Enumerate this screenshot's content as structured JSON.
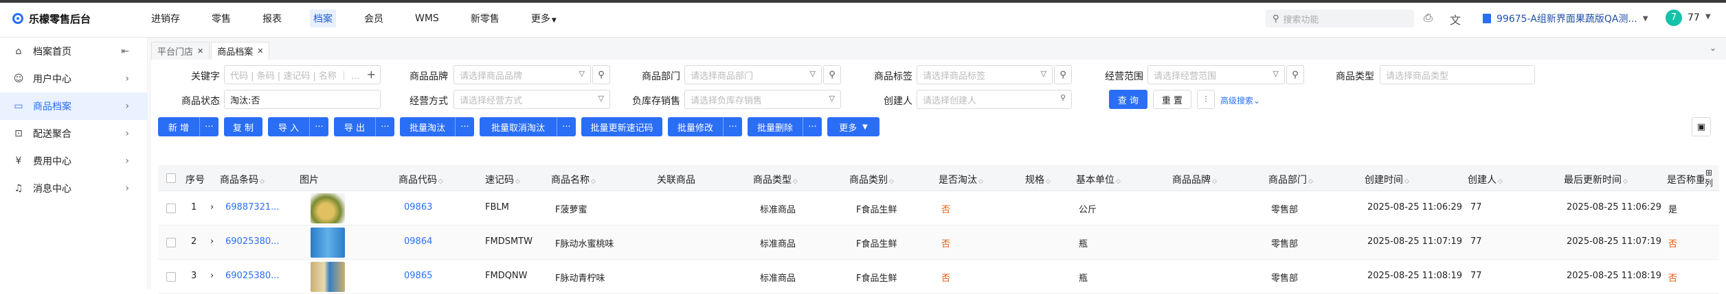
{
  "app": {
    "title": "乐檬零售后台"
  },
  "nav": [
    {
      "label": "进销存"
    },
    {
      "label": "零售"
    },
    {
      "label": "报表"
    },
    {
      "label": "档案"
    },
    {
      "label": "会员"
    },
    {
      "label": "WMS"
    },
    {
      "label": "新零售"
    },
    {
      "label": "更多"
    }
  ],
  "topbar": {
    "search_placeholder": "搜索功能",
    "org": "99675-A组新界面果蔬版QA测...",
    "avatar_text": "7",
    "user": "77"
  },
  "sidebar": [
    {
      "label": "档案首页"
    },
    {
      "label": "用户中心"
    },
    {
      "label": "商品档案"
    },
    {
      "label": "配送聚合"
    },
    {
      "label": "费用中心"
    },
    {
      "label": "消息中心"
    }
  ],
  "tabs": [
    {
      "label": "平台门店"
    },
    {
      "label": "商品档案"
    }
  ],
  "filters": {
    "keyword_label": "关键字",
    "keyword_ph": "代码 | 条码 | 速记码 | 名称 ｜ ...",
    "brand_label": "商品品牌",
    "brand_ph": "请选择商品品牌",
    "dept_label": "商品部门",
    "dept_ph": "请选择商品部门",
    "tag_label": "商品标签",
    "tag_ph": "请选择商品标签",
    "scope_label": "经营范围",
    "scope_ph": "请选择经营范围",
    "type_label": "商品类型",
    "type_ph": "请选择商品类型",
    "status_label": "商品状态",
    "status_value": "淘汰:否",
    "mode_label": "经营方式",
    "mode_ph": "请选择经营方式",
    "neg_label": "负库存销售",
    "neg_ph": "请选择负库存销售",
    "creator_label": "创建人",
    "creator_ph": "请选择创建人",
    "query": "查 询",
    "reset": "重 置",
    "advanced": "高级搜索"
  },
  "actions": {
    "add": "新 增",
    "copy": "复 制",
    "import": "导 入",
    "export": "导 出",
    "batch_obsolete": "批量淘汰",
    "batch_cancel": "批量取消淘汰",
    "batch_barcode": "批量更新速记码",
    "batch_edit": "批量修改",
    "batch_delete": "批量删除",
    "more": "更多",
    "dots": "···"
  },
  "table": {
    "headers": {
      "seq": "序号",
      "barcode": "商品条码",
      "image": "图片",
      "code": "商品代码",
      "shortcode": "速记码",
      "name": "商品名称",
      "linked": "关联商品",
      "ptype": "商品类型",
      "category": "商品类别",
      "obsolete": "是否淘汰",
      "spec": "规格",
      "unit": "基本单位",
      "brand": "商品品牌",
      "dept": "商品部门",
      "created": "创建时间",
      "creator": "创建人",
      "updated": "最后更新时间",
      "weigh": "是否称重",
      "settings": "列"
    },
    "rows": [
      {
        "seq": "1",
        "barcode": "69887321...",
        "code": "09863",
        "shortcode": "FBLM",
        "name": "F菠萝蜜",
        "ptype": "标准商品",
        "category": "F食品生鲜",
        "obsolete": "否",
        "unit": "公斤",
        "dept": "零售部",
        "created": "2025-08-25 11:06:29",
        "creator": "77",
        "updated": "2025-08-25 11:06:29",
        "weigh": "是",
        "thumb_color": "#8a9a3a"
      },
      {
        "seq": "2",
        "barcode": "69025380...",
        "code": "09864",
        "shortcode": "FMDSMTW",
        "name": "F脉动水蜜桃味",
        "ptype": "标准商品",
        "category": "F食品生鲜",
        "obsolete": "否",
        "unit": "瓶",
        "dept": "零售部",
        "created": "2025-08-25 11:07:19",
        "creator": "77",
        "updated": "2025-08-25 11:07:19",
        "weigh": "否",
        "thumb_color": "#3d8fd6"
      },
      {
        "seq": "3",
        "barcode": "69025380...",
        "code": "09865",
        "shortcode": "FMDQNW",
        "name": "F脉动青柠味",
        "ptype": "标准商品",
        "category": "F食品生鲜",
        "obsolete": "否",
        "unit": "瓶",
        "dept": "零售部",
        "created": "2025-08-25 11:08:19",
        "creator": "77",
        "updated": "2025-08-25 11:08:19",
        "weigh": "否",
        "thumb_color": "#c9b071"
      }
    ]
  }
}
